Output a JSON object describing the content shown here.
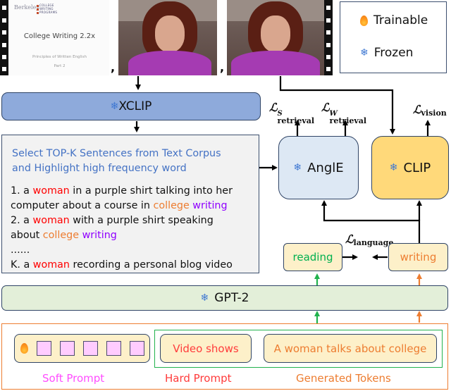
{
  "frames": [
    {
      "type": "slide",
      "logo_left": "Berkeley",
      "logo_right": [
        "COLLEGE",
        "WRITING",
        "PROGRAMS"
      ],
      "title": "College Writing 2.2x",
      "subtitle": "Principles of Written English",
      "part": "Part 2"
    },
    {
      "type": "video",
      "description": "woman in purple shirt talking to camera"
    },
    {
      "type": "video",
      "description": "woman in purple shirt talking to camera"
    }
  ],
  "separators": [
    ",",
    ","
  ],
  "legend": {
    "trainable": {
      "icon": "flame-icon",
      "label": "Trainable"
    },
    "frozen": {
      "icon": "snowflake-icon",
      "label": "Frozen"
    }
  },
  "icons": {
    "snowflake": "❄"
  },
  "xclip": {
    "label": "XCLIP"
  },
  "corpus_box": {
    "title_line1": "Select TOP-K Sentences from Text Corpus",
    "title_line2": "and Highlight high frequency word",
    "items": [
      {
        "lines": [
          [
            {
              "t": "1.  a "
            },
            {
              "t": "woman",
              "c": "red"
            },
            {
              "t": " in a purple shirt talking into her"
            }
          ],
          [
            {
              "t": "computer about a course in "
            },
            {
              "t": "college",
              "c": "orange"
            },
            {
              "t": " "
            },
            {
              "t": "writing",
              "c": "purple"
            }
          ]
        ]
      },
      {
        "lines": [
          [
            {
              "t": "2.  a "
            },
            {
              "t": "woman",
              "c": "red"
            },
            {
              "t": " with a purple shirt speaking"
            }
          ],
          [
            {
              "t": "about "
            },
            {
              "t": "college",
              "c": "orange"
            },
            {
              "t": " "
            },
            {
              "t": "writing",
              "c": "purple"
            }
          ]
        ]
      },
      {
        "lines": [
          [
            {
              "t": "......"
            }
          ]
        ]
      },
      {
        "lines": [
          [
            {
              "t": "K.  a "
            },
            {
              "t": "woman",
              "c": "red"
            },
            {
              "t": " recording a personal blog video"
            }
          ]
        ]
      }
    ]
  },
  "angle": {
    "label": "AnglE"
  },
  "clip": {
    "label": "CLIP"
  },
  "losses": {
    "retrieval_s": {
      "symbol": "ℒ",
      "sup": "S",
      "sub": "retrieval"
    },
    "retrieval_w": {
      "symbol": "ℒ",
      "sup": "W",
      "sub": "retrieval"
    },
    "vision": {
      "symbol": "ℒ",
      "sub": "vision"
    },
    "language": {
      "symbol": "ℒ",
      "sub": "language"
    }
  },
  "reading": {
    "label": "reading"
  },
  "writing": {
    "label": "writing"
  },
  "gpt": {
    "label": "GPT-2"
  },
  "prompt": {
    "soft_tokens": 5,
    "hard_text": "Video shows",
    "generated_text": "A woman talks about college",
    "captions": {
      "soft": "Soft Prompt",
      "hard": "Hard Prompt",
      "generated": "Generated Tokens"
    }
  },
  "colors": {
    "xclip_fill": "#8eaadb",
    "angle_fill": "#dde8f4",
    "clip_fill": "#ffd97a",
    "gpt_fill": "#e3efd9",
    "token_fill": "#ffccff",
    "pill_fill": "#fdf0c9",
    "corpus_title": "#4472c4",
    "highlight_red": "#ff0000",
    "highlight_orange": "#ed7d31",
    "highlight_purple": "#8f00ff",
    "reading_text": "#00b050",
    "writing_text": "#ed7d31",
    "soft_caption": "#ff4dff",
    "hard_caption": "#ff3b3b",
    "generated_caption": "#ed7d31",
    "outer_border": "#ed7d31",
    "green_border": "#21b24d"
  }
}
